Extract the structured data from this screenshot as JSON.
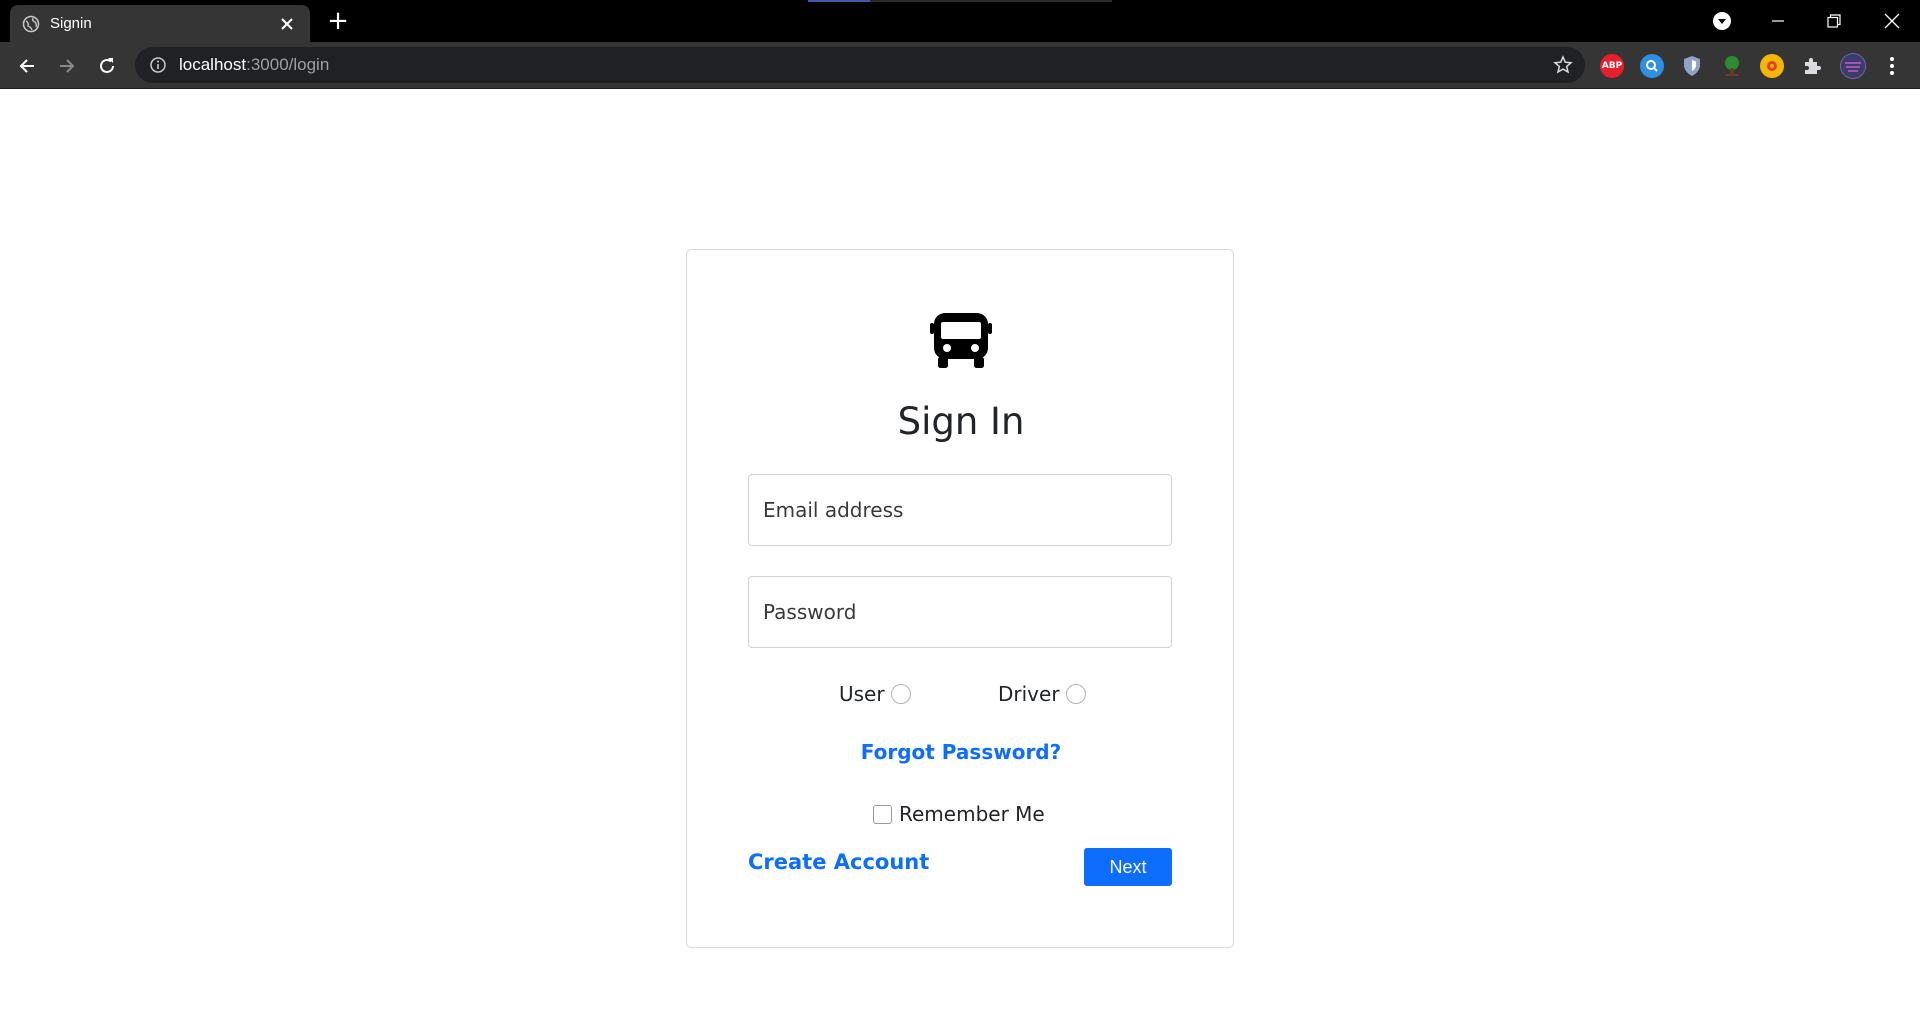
{
  "browser": {
    "tab_title": "Signin",
    "new_tab_symbol": "+",
    "url_host": "localhost",
    "url_path": ":3000/login",
    "extensions": [
      {
        "name": "adblock-plus-icon",
        "label": "ABP",
        "color": "#e4202e"
      },
      {
        "name": "search-extension-icon",
        "label": "",
        "color": "#2f8fe0"
      },
      {
        "name": "shield-extension-icon",
        "label": "",
        "color": "#8ea3c7"
      },
      {
        "name": "tree-extension-icon",
        "label": "",
        "color": "#2e8b2e"
      },
      {
        "name": "color-extension-icon",
        "label": "",
        "color": "#f2b705"
      },
      {
        "name": "puzzle-extensions-icon",
        "label": "",
        "color": "#dadce0"
      },
      {
        "name": "profile-avatar",
        "label": "",
        "color": "#3d3b6e"
      }
    ]
  },
  "page": {
    "title": "Sign In",
    "email_placeholder": "Email address",
    "password_placeholder": "Password",
    "role_user_label": "User",
    "role_driver_label": "Driver",
    "forgot_link": "Forgot Password?",
    "remember_label": "Remember Me",
    "create_account_link": "Create Account",
    "next_button": "Next"
  },
  "colors": {
    "primary": "#0d6efd",
    "tabbar": "#000000",
    "toolbar": "#353535"
  }
}
